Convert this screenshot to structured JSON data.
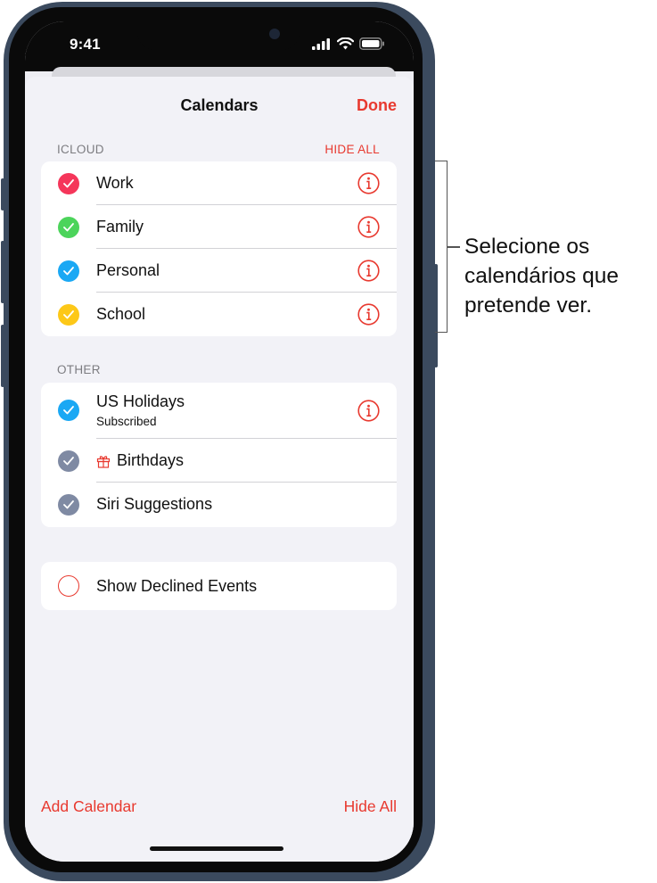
{
  "status_bar": {
    "time": "9:41"
  },
  "nav": {
    "title": "Calendars",
    "done_label": "Done"
  },
  "icloud": {
    "header": "ICLOUD",
    "hide_all_label": "HIDE ALL",
    "items": [
      {
        "label": "Work",
        "color": "#f5365a",
        "checked": true
      },
      {
        "label": "Family",
        "color": "#4cd45b",
        "checked": true
      },
      {
        "label": "Personal",
        "color": "#1aa8f4",
        "checked": true
      },
      {
        "label": "School",
        "color": "#fdc818",
        "checked": true
      }
    ]
  },
  "other": {
    "header": "OTHER",
    "items": [
      {
        "label": "US Holidays",
        "sublabel": "Subscribed",
        "color": "#1aa8f4",
        "checked": true
      },
      {
        "label": "Birthdays",
        "icon": "gift-icon",
        "color": "#7f8aa3",
        "checked": true
      },
      {
        "label": "Siri Suggestions",
        "color": "#7f8aa3",
        "checked": true
      }
    ]
  },
  "declined": {
    "label": "Show Declined Events",
    "checked": false
  },
  "footer": {
    "add_calendar_label": "Add Calendar",
    "hide_all_label": "Hide All"
  },
  "callout": {
    "lines": [
      "Selecione os",
      "calendários que",
      "pretende ver."
    ]
  },
  "colors": {
    "accent": "#e8392f",
    "background": "#f2f2f7",
    "frame": "#3b4a5e"
  }
}
